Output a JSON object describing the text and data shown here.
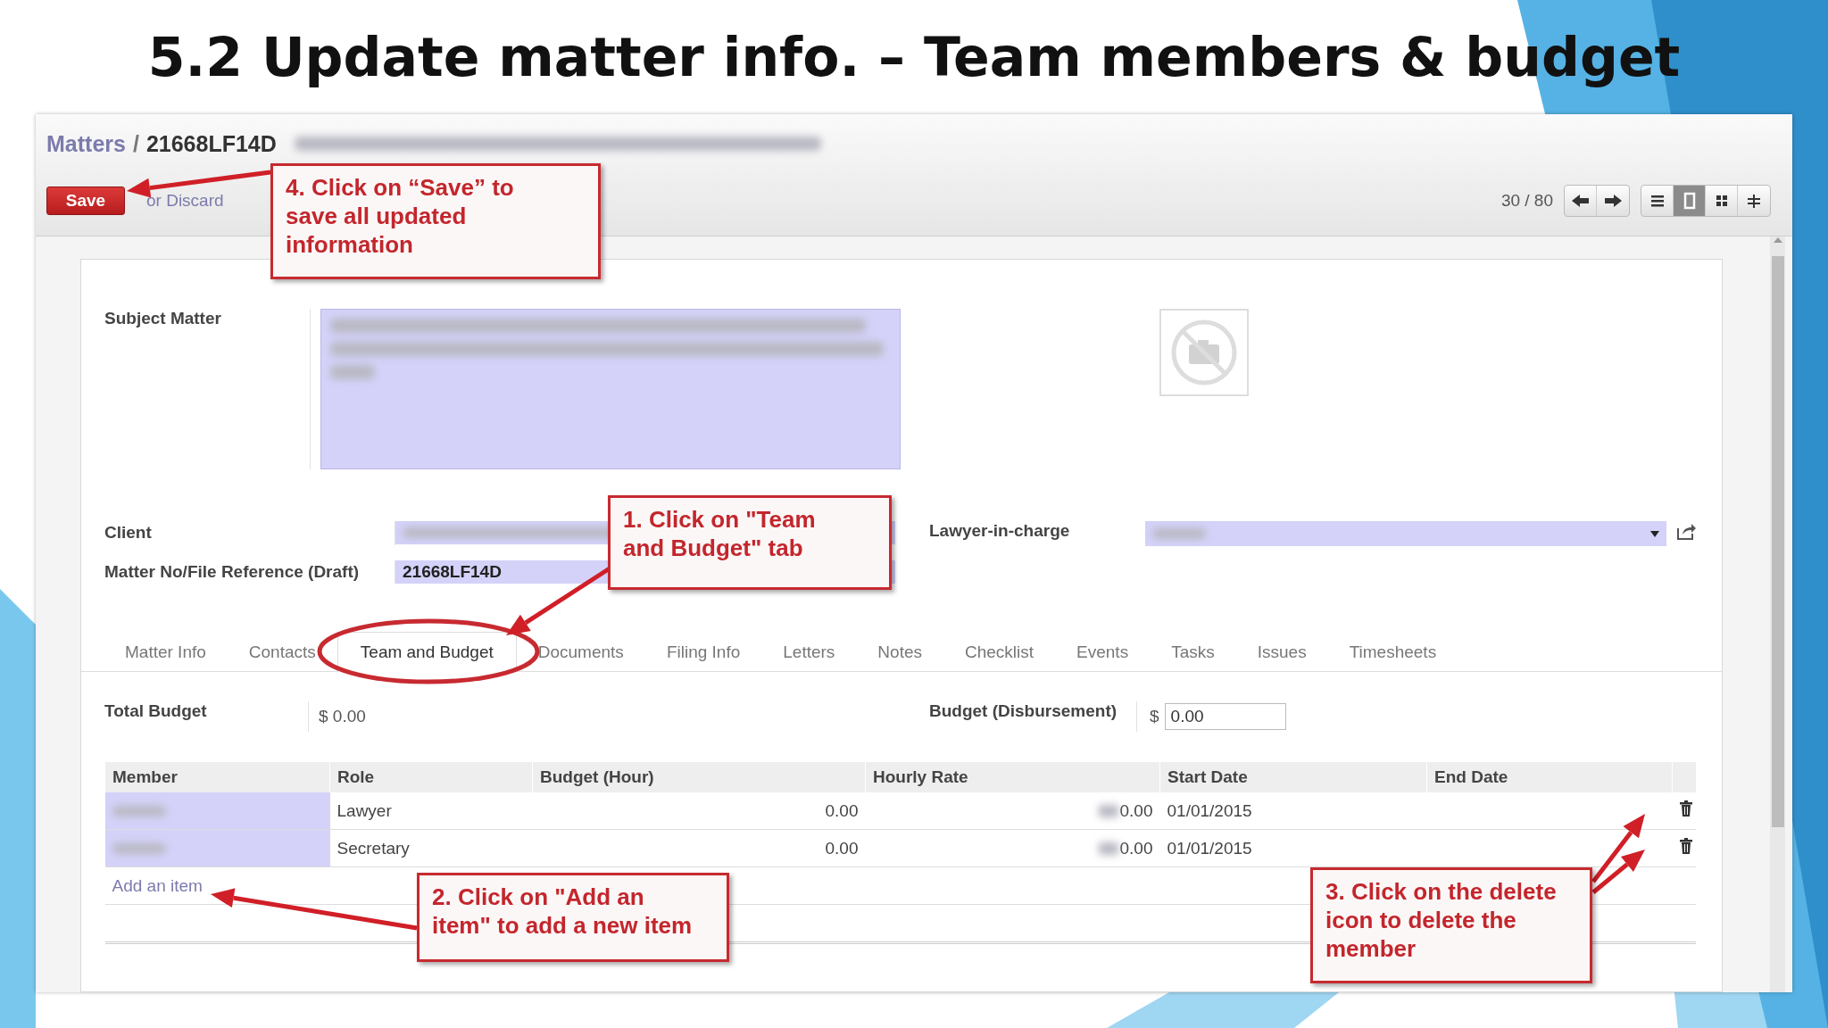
{
  "slide_title": "5.2 Update matter info. – Team members & budget",
  "breadcrumb": {
    "parent": "Matters",
    "separator": "/",
    "current": "21668LF14D"
  },
  "actions": {
    "save": "Save",
    "discard": "or Discard"
  },
  "pager": {
    "count": "30 / 80"
  },
  "view_modes": [
    {
      "kind": "list",
      "selected": false
    },
    {
      "kind": "form",
      "selected": true
    },
    {
      "kind": "kanban",
      "selected": false
    },
    {
      "kind": "gantt",
      "selected": false
    }
  ],
  "form": {
    "subject_matter_label": "Subject Matter",
    "client_label": "Client",
    "matter_no_label": "Matter No/File Reference (Draft)",
    "matter_no_value": "21668LF14D",
    "lawyer_label": "Lawyer-in-charge"
  },
  "tabs": [
    {
      "label": "Matter Info",
      "selected": false
    },
    {
      "label": "Contacts",
      "selected": false
    },
    {
      "label": "Team and Budget",
      "selected": true
    },
    {
      "label": "Documents",
      "selected": false
    },
    {
      "label": "Filing Info",
      "selected": false
    },
    {
      "label": "Letters",
      "selected": false
    },
    {
      "label": "Notes",
      "selected": false
    },
    {
      "label": "Checklist",
      "selected": false
    },
    {
      "label": "Events",
      "selected": false
    },
    {
      "label": "Tasks",
      "selected": false
    },
    {
      "label": "Issues",
      "selected": false
    },
    {
      "label": "Timesheets",
      "selected": false
    }
  ],
  "budget": {
    "total_label": "Total Budget",
    "total_value": "$ 0.00",
    "disbursement_label": "Budget (Disbursement)",
    "currency": "$",
    "disbursement_value": "0.00"
  },
  "table": {
    "columns": [
      "Member",
      "Role",
      "Budget (Hour)",
      "Hourly Rate",
      "Start Date",
      "End Date"
    ],
    "rows": [
      {
        "role": "Lawyer",
        "budget_hour": "0.00",
        "hourly_rate": "0.00",
        "start_date": "01/01/2015"
      },
      {
        "role": "Secretary",
        "budget_hour": "0.00",
        "hourly_rate": "0.00",
        "start_date": "01/01/2015"
      }
    ],
    "add_item": "Add an item"
  },
  "callouts": {
    "save": "4. Click on “Save” to save all updated information",
    "tab": "1. Click on \"Team and Budget\" tab",
    "add_item": "2. Click on \"Add an item\" to add a new item",
    "delete": "3. Click on the delete icon to delete the member"
  }
}
